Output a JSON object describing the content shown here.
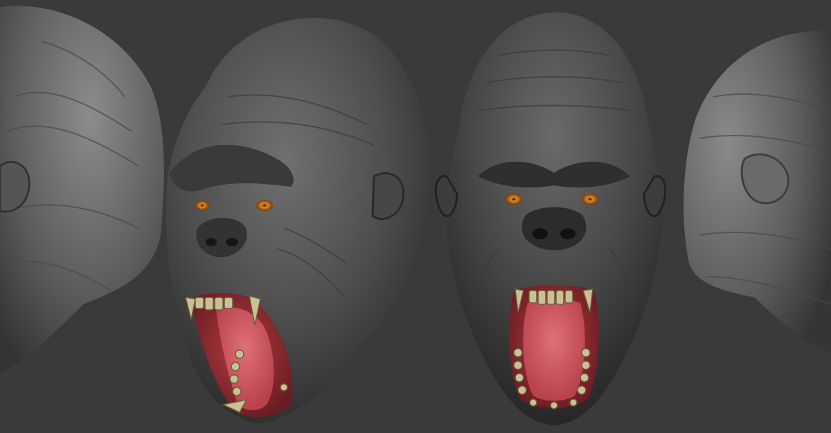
{
  "scene": {
    "background_color": "#3a3a3a",
    "views": [
      {
        "name": "gorilla-head-back-left-view"
      },
      {
        "name": "gorilla-head-three-quarter-view"
      },
      {
        "name": "gorilla-head-front-view"
      },
      {
        "name": "gorilla-head-side-right-view"
      }
    ]
  },
  "colors": {
    "skin_dark": "#2c2c2c",
    "skin_mid": "#4a4a4a",
    "skin_light": "#6e6e6e",
    "eye": "#c8741a",
    "mouth_inner": "#8e2a2e",
    "tongue": "#d2555e",
    "teeth": "#cbbf95"
  }
}
